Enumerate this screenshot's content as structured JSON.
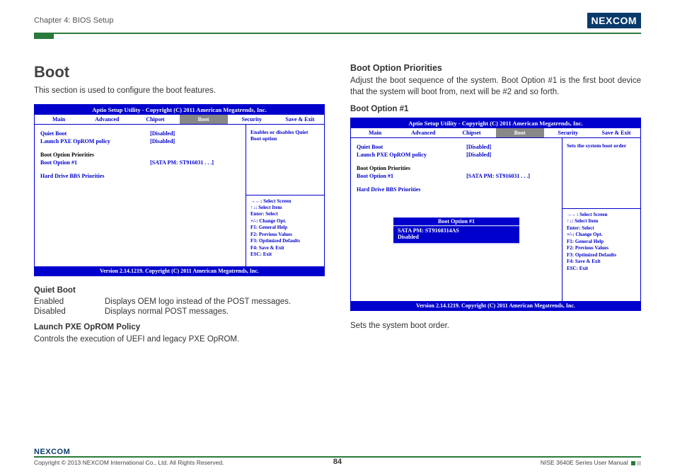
{
  "header": {
    "chapter": "Chapter 4: BIOS Setup",
    "logo_text": "NEXCOM"
  },
  "left": {
    "title": "Boot",
    "intro": "This section is used to configure the boot features.",
    "bios": {
      "title": "Aptio Setup Utility - Copyright (C) 2011 American Megatrends, Inc.",
      "tabs": [
        "Main",
        "Advanced",
        "Chipset",
        "Boot",
        "Security",
        "Save & Exit"
      ],
      "options": {
        "quiet_boot": {
          "label": "Quiet Boot",
          "value": "[Disabled]"
        },
        "pxe": {
          "label": "Launch PXE OpROM policy",
          "value": "[Disabled]"
        },
        "priorities_label": "Boot Option Priorities",
        "boot1": {
          "label": "Boot Option #1",
          "value": "[SATA PM: ST916031 . . .]"
        },
        "hdd_bbs": "Hard Drive BBS Priorities"
      },
      "help": "Enables or disables Quiet Boot option",
      "keys": [
        "→←: Select Screen",
        "↑↓: Select Item",
        "Enter: Select",
        "+/-: Change Opt.",
        "F1: General Help",
        "F2: Previous Values",
        "F3: Optimized Defaults",
        "F4: Save & Exit",
        "ESC: Exit"
      ],
      "footer": "Version 2.14.1219. Copyright (C) 2011 American Megatrends, Inc."
    },
    "quiet_boot_h": "Quiet Boot",
    "quiet_boot_rows": {
      "enabled": {
        "k": "Enabled",
        "v": "Displays OEM logo instead of the POST messages."
      },
      "disabled": {
        "k": "Disabled",
        "v": "Displays normal POST messages."
      }
    },
    "pxe_h": "Launch PXE OpROM Policy",
    "pxe_desc": "Controls the execution of UEFI and legacy PXE OpROM."
  },
  "right": {
    "title": "Boot Option Priorities",
    "desc": "Adjust the boot sequence of the system. Boot Option #1 is the first boot device that the system will boot from, next will be #2 and so forth.",
    "sub_h": "Boot Option #1",
    "bios": {
      "title": "Aptio Setup Utility - Copyright (C) 2011 American Megatrends, Inc.",
      "tabs": [
        "Main",
        "Advanced",
        "Chipset",
        "Boot",
        "Security",
        "Save & Exit"
      ],
      "options": {
        "quiet_boot": {
          "label": "Quiet Boot",
          "value": "[Disabled]"
        },
        "pxe": {
          "label": "Launch PXE OpROM policy",
          "value": "[Disabled]"
        },
        "priorities_label": "Boot Option Priorities",
        "boot1": {
          "label": "Boot Option #1",
          "value": "[SATA PM: ST916031 . . .]"
        },
        "hdd_bbs": "Hard Drive BBS Priorities"
      },
      "help": "Sets the system boot order",
      "popup": {
        "title": "Boot Option #1",
        "sel": "SATA PM: ST9160314AS",
        "dis": "Disabled"
      },
      "keys": [
        "→←: Select Screen",
        "↑↓: Select Item",
        "Enter: Select",
        "+/-: Change Opt.",
        "F1: General Help",
        "F2: Previous Values",
        "F3: Optimized Defaults",
        "F4: Save & Exit",
        "ESC: Exit"
      ],
      "footer": "Version 2.14.1219. Copyright (C) 2011 American Megatrends, Inc."
    },
    "caption": "Sets the system boot order."
  },
  "footer": {
    "copyright": "Copyright © 2013 NEXCOM International Co., Ltd. All Rights Reserved.",
    "page_num": "84",
    "manual": "NISE 3640E Series User Manual",
    "logo": "NEXCOM"
  }
}
